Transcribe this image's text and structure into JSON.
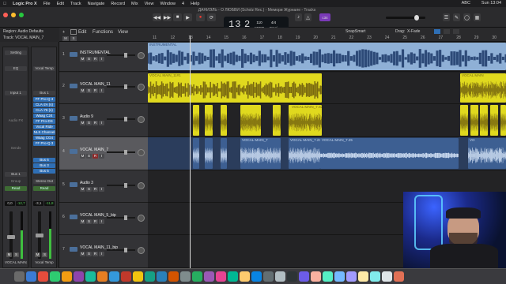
{
  "menubar": {
    "app": "Logic Pro X",
    "items": [
      "File",
      "Edit",
      "Track",
      "Navigate",
      "Record",
      "Mix",
      "View",
      "Window",
      "4",
      "Help"
    ],
    "status": [
      "ABC",
      "Sun 13:04"
    ]
  },
  "window": {
    "title": "ДАНИЭЛЬ - О ЛЮБВИ (Scholz Rec.) - Мемори Журнале - Tracks"
  },
  "lcd": {
    "bar": "13",
    "beat": "2",
    "tempo": "110",
    "tempo_label": "KEEP",
    "sig": "4/4",
    "key": "Cmaj"
  },
  "badge": "c34",
  "inspector": {
    "region": "Region: Audio Defaults",
    "track": "Track: VOCAL MAIN_7",
    "left": {
      "label_top": "Setting",
      "eq": "EQ",
      "input": "Input 1",
      "slots": [
        "Audio FX"
      ],
      "send": "Sends",
      "out": "Bus 1",
      "group": "Group",
      "auto": "Read",
      "vol": "0,0",
      "peak": "-12,7",
      "ms": [
        "M",
        "S"
      ],
      "name": "VOCAL MAIN_7"
    },
    "right": {
      "label_top": "Vocal Temp",
      "bus": "Bus 1",
      "plugins": [
        "FF Pro-Q 3",
        "CLA-2A (s)",
        "CLA-76 (s)",
        "Waag C24",
        "FF Pro-DS",
        "Vocal Ride",
        "NLS Channel",
        "Waag CG4",
        "FF Pro-Q 3"
      ],
      "sends": [
        "Bus 6",
        "Bus 3",
        "Bus 5"
      ],
      "out": "Stereo Out",
      "auto": "Read",
      "vol": "-3,1",
      "peak": "-11,8",
      "ms": [
        "M",
        "S"
      ],
      "name": "Vocal Temp"
    }
  },
  "tracks_toolbar": {
    "edit": "Edit",
    "functions": "Functions",
    "view": "View",
    "snap_label": "Snap:",
    "snap": "Smart",
    "drag_label": "Drag:",
    "drag": "X-Fade"
  },
  "tracks": [
    {
      "num": "1",
      "name": "INSTRUMENTAL",
      "btns": [
        "M",
        "S",
        "R",
        "I"
      ]
    },
    {
      "num": "2",
      "name": "VOCAL MAIN_11",
      "btns": [
        "M",
        "S",
        "R",
        "I"
      ]
    },
    {
      "num": "3",
      "name": "Audio 9",
      "btns": [
        "M",
        "S",
        "R",
        "I"
      ]
    },
    {
      "num": "4",
      "name": "VOCAL MAIN_7",
      "btns": [
        "M",
        "S",
        "R",
        "I"
      ]
    },
    {
      "num": "5",
      "name": "Audio 3",
      "btns": [
        "M",
        "S",
        "R",
        "I"
      ]
    },
    {
      "num": "6",
      "name": "VOCAL MAIN_5_bip",
      "btns": [
        "M",
        "S",
        "R",
        "I"
      ]
    },
    {
      "num": "7",
      "name": "VOCAL MAIN_11_bip",
      "btns": [
        "M",
        "S",
        "R",
        "I"
      ]
    }
  ],
  "ruler": [
    "11",
    "12",
    "13",
    "14",
    "15",
    "16",
    "17",
    "18",
    "19",
    "20",
    "21",
    "22",
    "23",
    "24",
    "25",
    "26",
    "27",
    "28",
    "29",
    "30"
  ],
  "regions": {
    "r2a": "VOCAL MAIN_11#1",
    "r2b": "VOCAL MAIN_11",
    "r2c": "VOCAL MAIN",
    "r3": "VOCAL MAIN_7.S2",
    "r4a": "VOCAL MAIN_7",
    "r4b": "VOCAL MAIN_7.23",
    "r4c": "VOCAL MAIN_7.25",
    "r4d": "VO",
    "r1": "INSTRUMENTAL"
  },
  "colors": {
    "audio_blue": "#5b7fb1",
    "yellow": "#e0d91e",
    "instrumental": "#8fb0d6",
    "selected_lane": "#2b3d5c"
  }
}
